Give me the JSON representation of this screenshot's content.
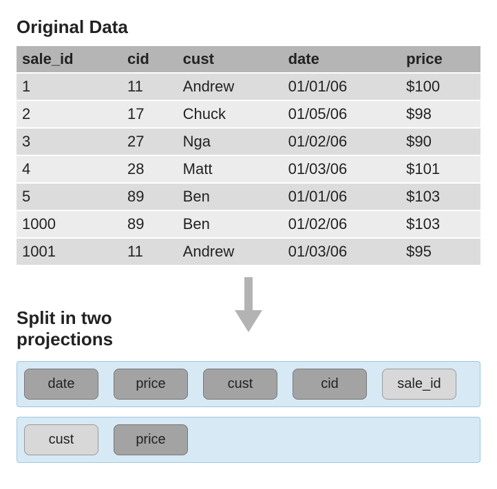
{
  "titles": {
    "original": "Original Data",
    "split": "Split in two projections"
  },
  "table": {
    "headers": [
      "sale_id",
      "cid",
      "cust",
      "date",
      "price"
    ],
    "rows": [
      [
        "1",
        "11",
        "Andrew",
        "01/01/06",
        "$100"
      ],
      [
        "2",
        "17",
        "Chuck",
        "01/05/06",
        "$98"
      ],
      [
        "3",
        "27",
        "Nga",
        "01/02/06",
        "$90"
      ],
      [
        "4",
        "28",
        "Matt",
        "01/03/06",
        "$101"
      ],
      [
        "5",
        "89",
        "Ben",
        "01/01/06",
        "$103"
      ],
      [
        "1000",
        "89",
        "Ben",
        "01/02/06",
        "$103"
      ],
      [
        "1001",
        "11",
        "Andrew",
        "01/03/06",
        "$95"
      ]
    ]
  },
  "projections": [
    {
      "pills": [
        {
          "label": "date",
          "shade": "dark"
        },
        {
          "label": "price",
          "shade": "dark"
        },
        {
          "label": "cust",
          "shade": "dark"
        },
        {
          "label": "cid",
          "shade": "dark"
        },
        {
          "label": "sale_id",
          "shade": "light"
        }
      ]
    },
    {
      "pills": [
        {
          "label": "cust",
          "shade": "light"
        },
        {
          "label": "price",
          "shade": "dark"
        }
      ]
    }
  ]
}
